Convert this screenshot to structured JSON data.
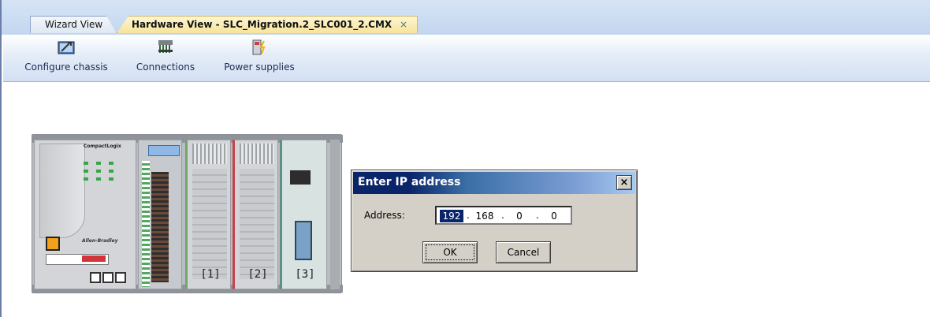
{
  "tabs": [
    {
      "label": "Wizard View",
      "active": false
    },
    {
      "label": "Hardware View - SLC_Migration.2_SLC001_2.CMX",
      "active": true,
      "close_glyph": "×"
    }
  ],
  "ribbon": {
    "configure_chassis": {
      "label": "Configure chassis",
      "icon": "configure-chassis-icon"
    },
    "connections": {
      "label": "Connections",
      "icon": "connections-icon"
    },
    "power_supplies": {
      "label": "Power supplies",
      "icon": "power-supplies-icon"
    }
  },
  "chassis": {
    "cpu_brand": "CompactLogix",
    "cpu_maker": "Allen-Bradley",
    "slots": [
      {
        "number": "[1]"
      },
      {
        "number": "[2]"
      },
      {
        "number": "[3]"
      }
    ]
  },
  "dialog": {
    "title": "Enter IP address",
    "close_glyph": "×",
    "address_label": "Address:",
    "ip": [
      "192",
      "168",
      "0",
      "0"
    ],
    "separator": ".",
    "ok_label": "OK",
    "cancel_label": "Cancel"
  },
  "colors": {
    "title_bar_start": "#0a246a",
    "title_bar_end": "#a6caf0",
    "active_tab": "#f7e39a",
    "ribbon": "#d3e0f3"
  }
}
